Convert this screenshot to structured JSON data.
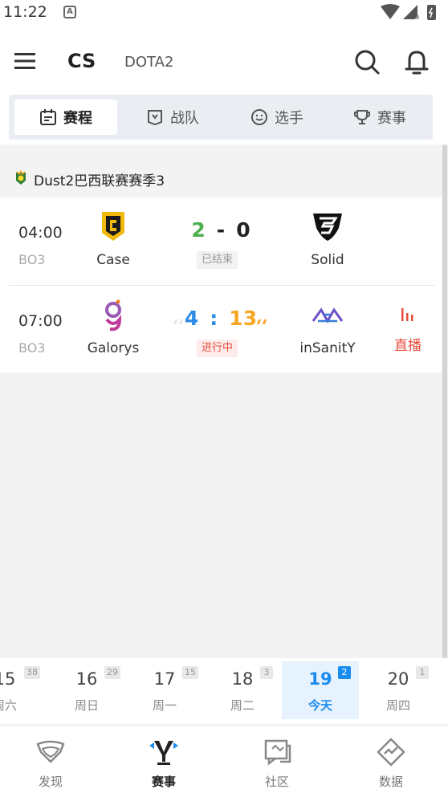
{
  "status_bar": {
    "time": "11:22",
    "notification_badge": "A"
  },
  "header": {
    "active_game": "CS",
    "other_game": "DOTA2",
    "icons": [
      "menu-icon",
      "search-icon",
      "bell-icon"
    ]
  },
  "tabs": [
    {
      "label": "赛程",
      "icon": "calendar-icon",
      "active": true
    },
    {
      "label": "战队",
      "icon": "team-shield-icon",
      "active": false
    },
    {
      "label": "选手",
      "icon": "player-face-icon",
      "active": false
    },
    {
      "label": "赛事",
      "icon": "trophy-icon",
      "active": false
    }
  ],
  "league": {
    "name": "Dust2巴西联赛赛季3"
  },
  "matches": [
    {
      "time": "04:00",
      "format": "BO3",
      "team_a": "Case",
      "team_b": "Solid",
      "score_a": "2",
      "score_b": "0",
      "separator": "-",
      "status": "已结束",
      "score_a_color": "#4caf50",
      "score_b_color": "#222222"
    },
    {
      "time": "07:00",
      "format": "BO3",
      "team_a": "Galorys",
      "team_b": "inSanitY",
      "score_a": "4",
      "score_b": "13",
      "separator": ":",
      "status": "进行中",
      "live_label": "直播",
      "score_a_color": "#2d8ce6",
      "score_b_color": "#f5a623"
    }
  ],
  "dates": [
    {
      "num": "15",
      "day": "周六",
      "count": "38",
      "active": false
    },
    {
      "num": "16",
      "day": "周日",
      "count": "29",
      "active": false
    },
    {
      "num": "17",
      "day": "周一",
      "count": "15",
      "active": false
    },
    {
      "num": "18",
      "day": "周二",
      "count": "3",
      "active": false
    },
    {
      "num": "19",
      "day": "今天",
      "count": "2",
      "active": true
    },
    {
      "num": "20",
      "day": "周四",
      "count": "1",
      "active": false
    }
  ],
  "bottom_nav": [
    {
      "label": "发现",
      "icon": "discover-icon",
      "active": false
    },
    {
      "label": "赛事",
      "icon": "trophy-cup-icon",
      "active": true
    },
    {
      "label": "社区",
      "icon": "community-icon",
      "active": false
    },
    {
      "label": "数据",
      "icon": "data-icon",
      "active": false
    }
  ],
  "colors": {
    "accent": "#1a8cf0",
    "live": "#e74c3c",
    "finished_gray": "#999999"
  }
}
